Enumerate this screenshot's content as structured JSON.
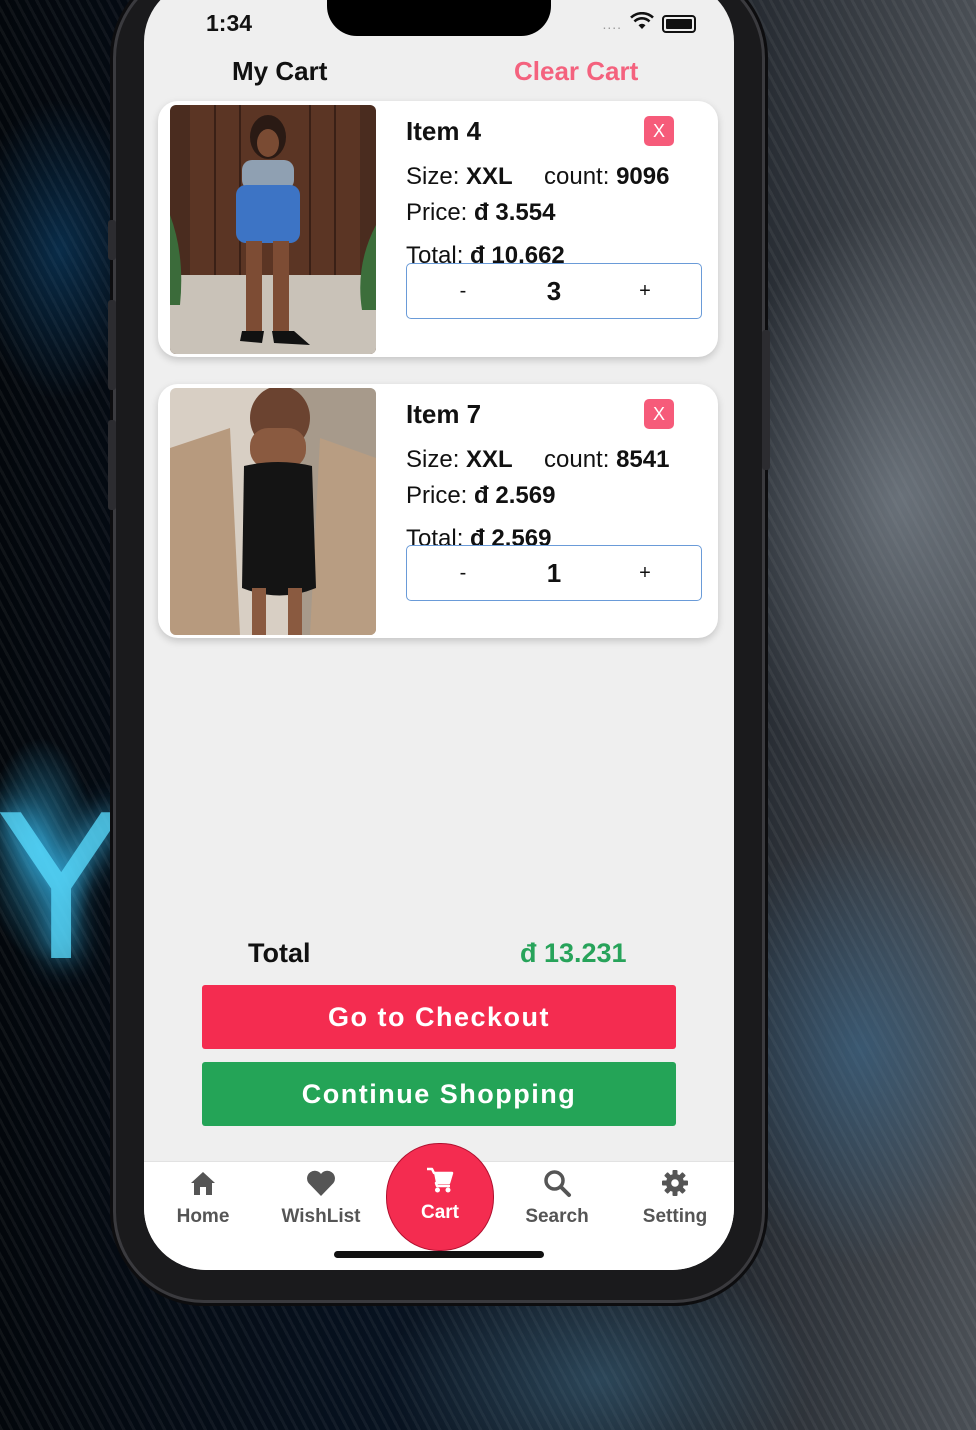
{
  "status_bar": {
    "time": "1:34",
    "signal_dots": "....",
    "wifi_icon": "wifi-icon",
    "battery_icon": "battery-icon"
  },
  "header": {
    "title": "My Cart",
    "clear_label": "Clear Cart"
  },
  "cart_items": [
    {
      "name": "Item 4",
      "remove_label": "X",
      "size_label": "Size:",
      "size_value": "XXL",
      "count_label": "count:",
      "count_value": "9096",
      "price_label": "Price:",
      "price_value": "đ 3.554",
      "total_label": "Total:",
      "total_value": "đ 10.662",
      "minus": "-",
      "quantity": "3",
      "plus": "+"
    },
    {
      "name": "Item 7",
      "remove_label": "X",
      "size_label": "Size:",
      "size_value": "XXL",
      "count_label": "count:",
      "count_value": "8541",
      "price_label": "Price:",
      "price_value": "đ 2.569",
      "total_label": "Total:",
      "total_value": "đ 2.569",
      "minus": "-",
      "quantity": "1",
      "plus": "+"
    }
  ],
  "summary": {
    "total_label": "Total",
    "total_value": "đ 13.231"
  },
  "actions": {
    "checkout_label": "Go to Checkout",
    "continue_label": "Continue Shopping"
  },
  "tabbar": {
    "items": [
      {
        "label": "Home",
        "icon": "home-icon"
      },
      {
        "label": "WishList",
        "icon": "heart-icon"
      },
      {
        "label": "Cart",
        "icon": "cart-icon",
        "active": true
      },
      {
        "label": "Search",
        "icon": "search-icon"
      },
      {
        "label": "Setting",
        "icon": "gear-icon"
      }
    ]
  },
  "colors": {
    "accent_pink": "#f4627e",
    "checkout_red": "#f42c50",
    "continue_green": "#24a457",
    "total_green": "#27a35a",
    "remove_pink": "#f65b7a"
  }
}
